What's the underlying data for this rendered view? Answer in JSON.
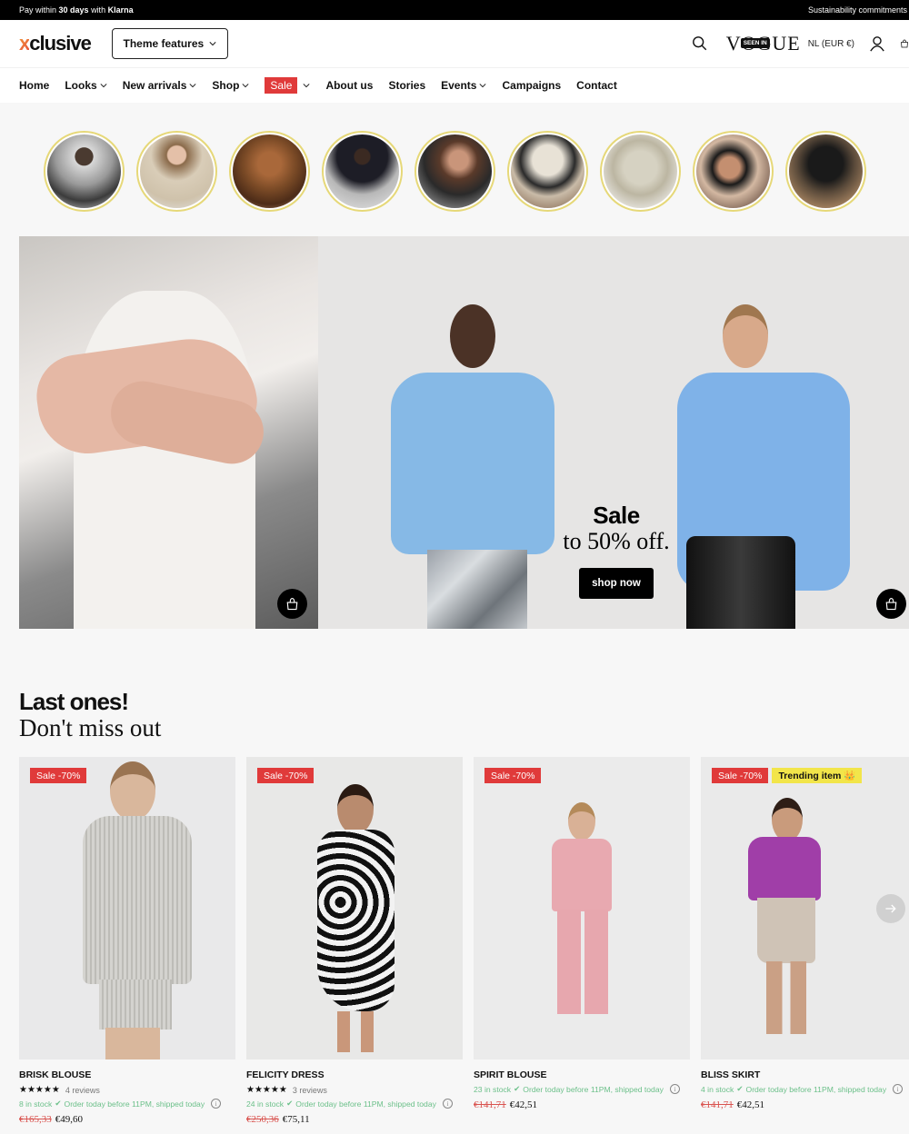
{
  "topbar": {
    "klarna_prefix": "Pay within ",
    "klarna_bold": "30 days",
    "klarna_mid": " with ",
    "klarna_brand": "Klarna",
    "right_link": "Sustainability commitments"
  },
  "header": {
    "logo_x": "x",
    "logo_rest": "clusive",
    "theme_features": "Theme features",
    "vogue_text": "VOGUE",
    "seen_in": "SEEN IN",
    "locale": "NL (EUR €)",
    "icons": [
      "search-icon",
      "user-icon",
      "cart-icon"
    ]
  },
  "nav": {
    "items": [
      {
        "label": "Home",
        "dropdown": false
      },
      {
        "label": "Looks",
        "dropdown": true
      },
      {
        "label": "New arrivals",
        "dropdown": true
      },
      {
        "label": "Shop",
        "dropdown": true
      },
      {
        "label": "Sale",
        "dropdown": true,
        "highlight": true
      },
      {
        "label": "About us",
        "dropdown": false
      },
      {
        "label": "Stories",
        "dropdown": false
      },
      {
        "label": "Events",
        "dropdown": true
      },
      {
        "label": "Campaigns",
        "dropdown": false
      },
      {
        "label": "Contact",
        "dropdown": false
      }
    ]
  },
  "stories": {
    "count": 9,
    "ring_color": "#e6d878"
  },
  "hero": {
    "promo_title": "Sale",
    "promo_sub": "to 50% off.",
    "cta": "shop now"
  },
  "section": {
    "title": "Last ones!",
    "subtitle": "Don't miss out"
  },
  "products": [
    {
      "badges": [
        "Sale -70%"
      ],
      "name": "BRISK BLOUSE",
      "stars": "★★★★★",
      "reviews": "4 reviews",
      "stock": "8 in stock",
      "shipping": "Order today before 11PM, shipped today",
      "old_price": "€165,33",
      "price": "€49,60"
    },
    {
      "badges": [
        "Sale -70%"
      ],
      "name": "FELICITY DRESS",
      "stars": "★★★★★",
      "reviews": "3 reviews",
      "stock": "24 in stock",
      "shipping": "Order today before 11PM, shipped today",
      "old_price": "€250,36",
      "price": "€75,11"
    },
    {
      "badges": [
        "Sale -70%"
      ],
      "name": "SPIRIT BLOUSE",
      "stars": null,
      "reviews": null,
      "stock": "23 in stock",
      "shipping": "Order today before 11PM, shipped today",
      "old_price": "€141,71",
      "price": "€42,51"
    },
    {
      "badges": [
        "Sale -70%"
      ],
      "trending": "Trending item 👑",
      "name": "BLISS SKIRT",
      "stars": null,
      "reviews": null,
      "stock": "4 in stock",
      "shipping": "Order today before 11PM, shipped today",
      "old_price": "€141,71",
      "price": "€42,51"
    }
  ],
  "colors": {
    "sale_red": "#e03a3a",
    "stock_green": "#6cc08a",
    "trend_yellow": "#f2e54a"
  }
}
